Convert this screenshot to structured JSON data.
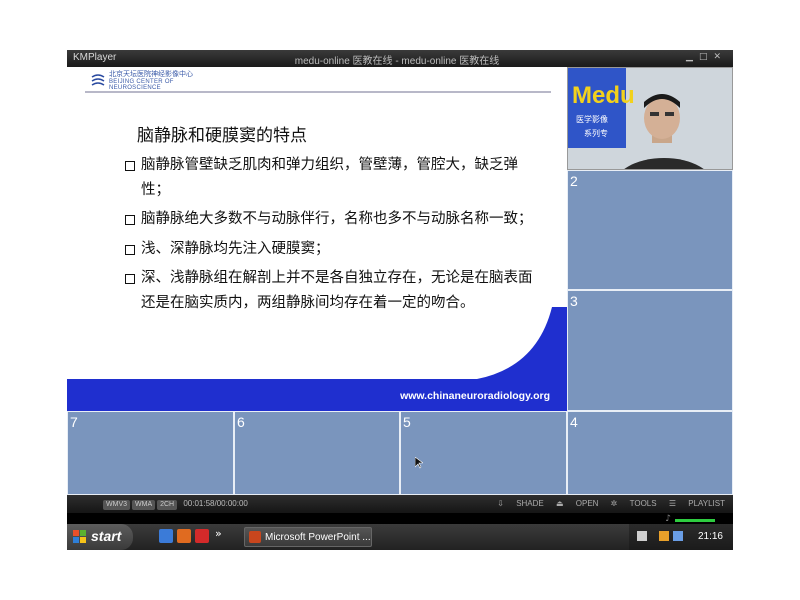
{
  "player": {
    "app_name": "KMPlayer",
    "window_title": "medu-online 医教在线 - medu-online 医教在线"
  },
  "slide": {
    "logo_line1": "北京天坛医院神经影像中心",
    "logo_line2": "BEIJING CENTER OF NEUROSCIENCE",
    "title": "脑静脉和硬膜窦的特点",
    "bullets": [
      "脑静脉管壁缺乏肌肉和弹力组织，管壁薄，管腔大，缺乏弹性；",
      "脑静脉绝大多数不与动脉伴行，名称也多不与动脉名称一致；",
      "浅、深静脉均先注入硬膜窦；",
      "深、浅静脉组在解剖上并不是各自独立存在，无论是在脑表面还是在脑实质内，两组静脉间均存在着一定的吻合。"
    ],
    "url": "www.chinaneuroradiology.org",
    "colors": {
      "banner": "#1f2fcf",
      "background": "#ffffff"
    }
  },
  "camera": {
    "sign_text": "Medu",
    "sign_sub1": "医学影像",
    "sign_sub2": "系列专"
  },
  "grid": {
    "cells": [
      "2",
      "3",
      "7",
      "6",
      "5",
      "4"
    ],
    "color": "#7a95bd"
  },
  "controls": {
    "pills": [
      "WMV3",
      "WMA",
      "2CH"
    ],
    "time": "00:01:58/00:00:00",
    "shade": "SHADE",
    "open": "OPEN",
    "tools": "TOOLS",
    "playlist": "PLAYLIST"
  },
  "taskbar": {
    "start_label": "start",
    "task_label": "Microsoft PowerPoint ...",
    "clock": "21:16",
    "overflow": "»"
  }
}
